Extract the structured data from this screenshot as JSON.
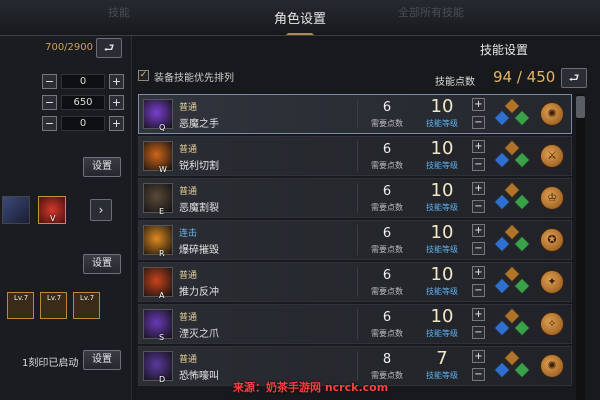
{
  "header": {
    "title": "角色设置",
    "tab_left_faded": "技能",
    "tab_right_faded": "全部所有技能"
  },
  "left_panel": {
    "points": "700/2900",
    "undo_icon": "undo-arrow-icon",
    "stepper_values": [
      "0",
      "650",
      "0"
    ],
    "minus_label": "−",
    "plus_label": "+",
    "set_label_1": "设置",
    "set_label_2": "设置",
    "set_label_3": "设置",
    "engrave_status": "1刻印已启动",
    "engrave_levels": [
      "Lv.7",
      "Lv.7",
      "Lv.7"
    ],
    "slot_key_v": "V",
    "next_icon": "chevron-right-icon"
  },
  "right_panel": {
    "title": "技能设置",
    "checkbox_label": "装备技能优先排列",
    "checkbox_checked": true,
    "skill_points_label": "技能点数",
    "skill_points_value": "94 / 450",
    "need_label": "需要点数",
    "level_label": "技能等级",
    "skills": [
      {
        "key": "Q",
        "type": "普通",
        "name": "恶魔之手",
        "need": "6",
        "level": "10",
        "color": "#7a3fd0",
        "rune": "✺"
      },
      {
        "key": "W",
        "type": "普通",
        "name": "锐利切割",
        "need": "6",
        "level": "10",
        "color": "#d0651a",
        "rune": "⚔"
      },
      {
        "key": "E",
        "type": "普通",
        "name": "恶魔割裂",
        "need": "6",
        "level": "10",
        "color": "#5a4a3a",
        "rune": "♔"
      },
      {
        "key": "R",
        "type": "连击",
        "name": "爆碎摧毁",
        "need": "6",
        "level": "10",
        "color": "#e08a20",
        "rune": "✪"
      },
      {
        "key": "A",
        "type": "普通",
        "name": "推力反冲",
        "need": "6",
        "level": "10",
        "color": "#c8431c",
        "rune": "✦"
      },
      {
        "key": "S",
        "type": "普通",
        "name": "湮灭之爪",
        "need": "6",
        "level": "10",
        "color": "#6a3ab8",
        "rune": "✧"
      },
      {
        "key": "D",
        "type": "普通",
        "name": "恐怖嚎叫",
        "need": "8",
        "level": "7",
        "color": "#5a3aa0",
        "rune": "✺"
      }
    ]
  },
  "watermark": "来源：奶茶手游网 ncrck.com",
  "colors": {
    "accent_gold": "#e6b65c",
    "level_blue": "#5fb0ef",
    "combo_blue": "#6fb6f0"
  }
}
